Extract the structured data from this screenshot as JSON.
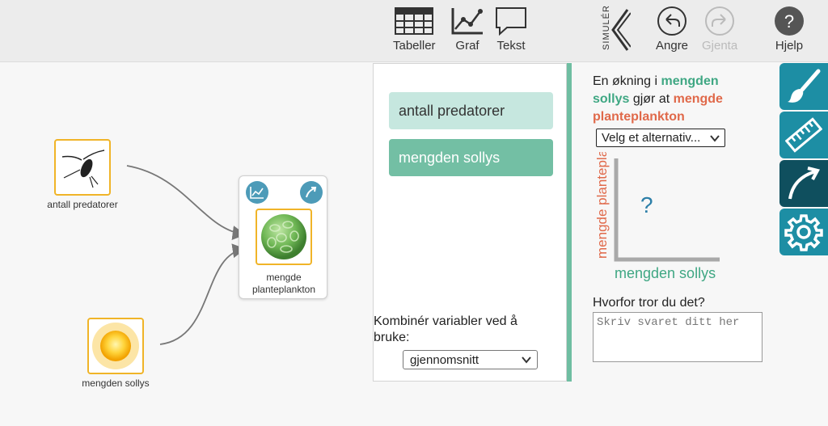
{
  "toolbar": {
    "tables_label": "Tabeller",
    "graph_label": "Graf",
    "text_label": "Tekst",
    "simulate_label": "SIMULÉR",
    "undo_label": "Angre",
    "redo_label": "Gjenta",
    "help_label": "Hjelp"
  },
  "canvas": {
    "node_predators_label": "antall predatorer",
    "node_sun_label": "mengden sollys",
    "node_plankton_label": "mengde planteplankton"
  },
  "relation_panel": {
    "var_predators": "antall predatorer",
    "var_sun": "mengden sollys",
    "combine_label": "Kombinér variabler ved å bruke:",
    "combine_value": "gjennomsnitt"
  },
  "question": {
    "prefix": "En økning i",
    "var1": "mengden sollys",
    "middle": "gjør at",
    "var2": "planteplankton",
    "var2_prefix": "mengde",
    "select_value": "Velg et alternativ...",
    "graph_y_label": "mengde planteplankton",
    "graph_x_label": "mengden sollys",
    "graph_unknown": "?",
    "why_label": "Hvorfor tror du det?",
    "why_placeholder": "Skriv svaret ditt her"
  },
  "colors": {
    "accent_green": "#73bfa4",
    "light_green": "#c6e7df",
    "orange": "#e0694a",
    "rail_teal": "#1d8ea4",
    "rail_dark": "#0f4f5e",
    "node_border": "#f0b428"
  },
  "icons": {
    "rail": [
      "paintbrush-icon",
      "ruler-icon",
      "curved-arrow-icon",
      "gear-icon"
    ]
  }
}
